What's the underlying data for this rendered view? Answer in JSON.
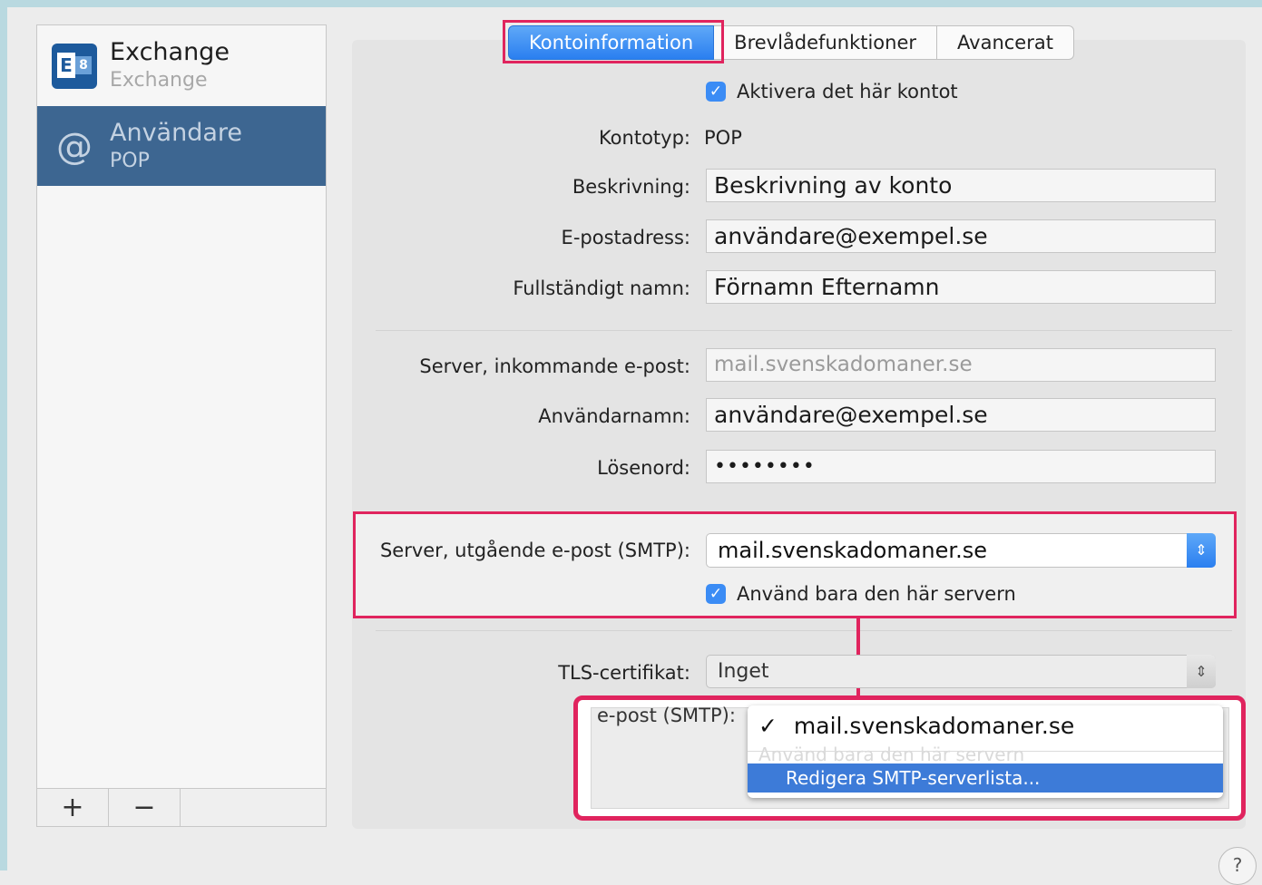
{
  "sidebar": {
    "accounts": [
      {
        "name": "Exchange",
        "type": "Exchange",
        "icon": "exchange-icon"
      },
      {
        "name": "Användare",
        "type": "POP",
        "icon": "at-sign-icon"
      }
    ],
    "add_label": "+",
    "remove_label": "−"
  },
  "tabs": [
    "Kontoinformation",
    "Brevlådefunktioner",
    "Avancerat"
  ],
  "active_tab": "Kontoinformation",
  "form": {
    "enable_label": "Aktivera det här kontot",
    "enable_checked": true,
    "account_type_label": "Kontotyp:",
    "account_type_value": "POP",
    "description_label": "Beskrivning:",
    "description_value": "Beskrivning av konto",
    "email_label": "E-postadress:",
    "email_value": "användare@exempel.se",
    "fullname_label": "Fullständigt namn:",
    "fullname_value": "Förnamn Efternamn",
    "incoming_label": "Server, inkommande e-post:",
    "incoming_value": "mail.svenskadomaner.se",
    "username_label": "Användarnamn:",
    "username_value": "användare@exempel.se",
    "password_label": "Lösenord:",
    "password_value": "••••••••",
    "smtp_label": "Server, utgående e-post (SMTP):",
    "smtp_value": "mail.svenskadomaner.se",
    "only_server_label": "Använd bara den här servern",
    "only_server_checked": true,
    "tls_label": "TLS-certifikat:",
    "tls_value": "Inget"
  },
  "popup": {
    "partial_label": "e-post (SMTP):",
    "selected_item": "mail.svenskadomaner.se",
    "checkmark": "✓",
    "ghost_text": "Använd bara den här servern",
    "edit_item": "Redigera SMTP-serverlista..."
  },
  "help_label": "?",
  "colors": {
    "accent": "#3b8cf5",
    "highlight": "#e0245e",
    "selected_row": "#3d6691"
  }
}
